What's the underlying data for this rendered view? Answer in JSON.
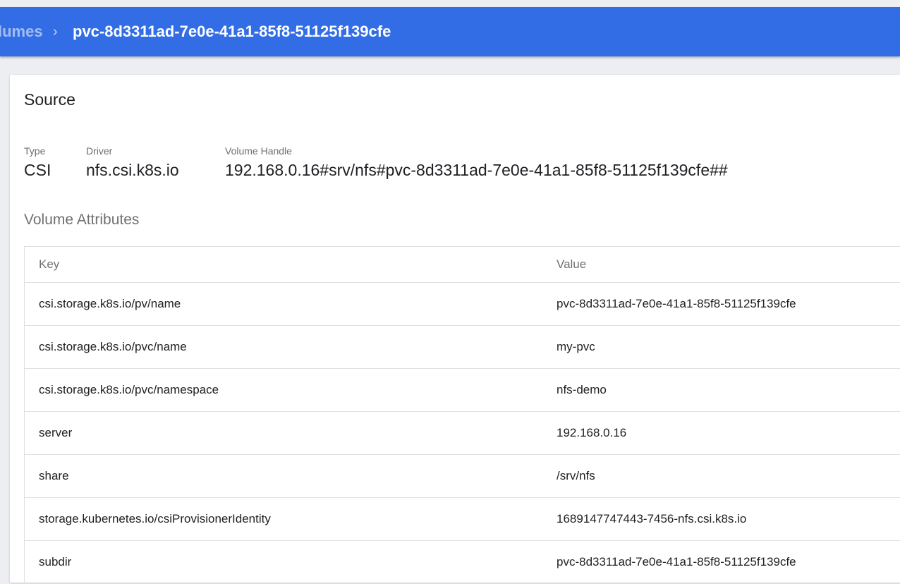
{
  "breadcrumb": {
    "parent": "lumes",
    "separator": "›",
    "current": "pvc-8d3311ad-7e0e-41a1-85f8-51125f139cfe"
  },
  "source": {
    "title": "Source",
    "type_label": "Type",
    "type_value": "CSI",
    "driver_label": "Driver",
    "driver_value": "nfs.csi.k8s.io",
    "handle_label": "Volume Handle",
    "handle_value": "192.168.0.16#srv/nfs#pvc-8d3311ad-7e0e-41a1-85f8-51125f139cfe##"
  },
  "attributes": {
    "title": "Volume Attributes",
    "key_header": "Key",
    "value_header": "Value",
    "rows": [
      {
        "key": "csi.storage.k8s.io/pv/name",
        "value": "pvc-8d3311ad-7e0e-41a1-85f8-51125f139cfe"
      },
      {
        "key": "csi.storage.k8s.io/pvc/name",
        "value": "my-pvc"
      },
      {
        "key": "csi.storage.k8s.io/pvc/namespace",
        "value": "nfs-demo"
      },
      {
        "key": "server",
        "value": "192.168.0.16"
      },
      {
        "key": "share",
        "value": "/srv/nfs"
      },
      {
        "key": "storage.kubernetes.io/csiProvisionerIdentity",
        "value": "1689147747443-7456-nfs.csi.k8s.io"
      },
      {
        "key": "subdir",
        "value": "pvc-8d3311ad-7e0e-41a1-85f8-51125f139cfe"
      }
    ]
  },
  "colors": {
    "topbar": "#326de6",
    "page_background": "#eceef1",
    "card": "#ffffff"
  }
}
